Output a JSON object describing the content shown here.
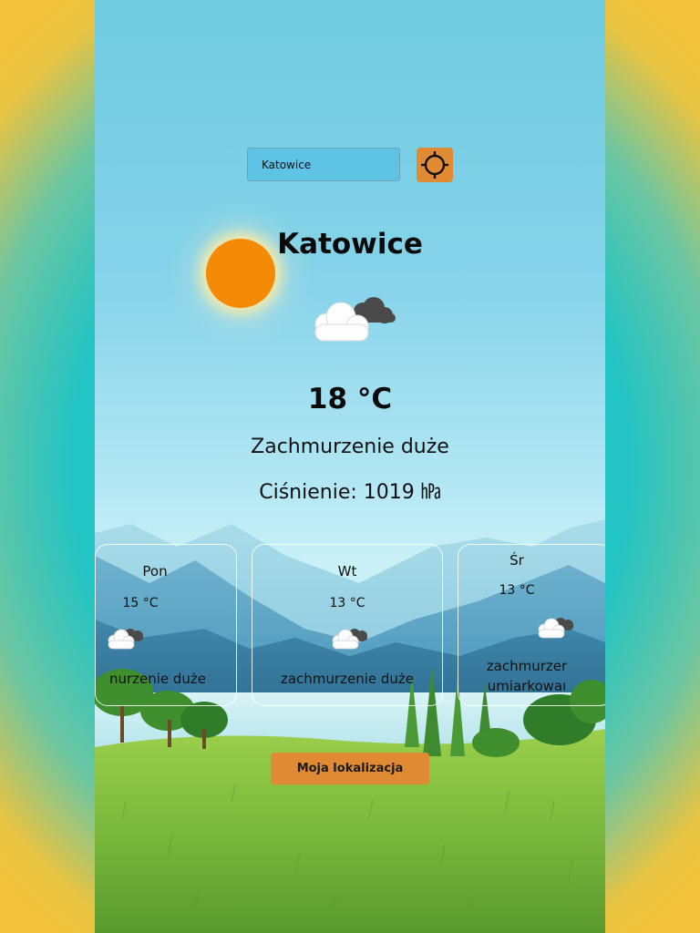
{
  "search": {
    "value": "Katowice"
  },
  "current": {
    "city": "Katowice",
    "temperature": "18 °C",
    "description": "Zachmurzenie duże",
    "pressure": "Ciśnienie: 1019 ㍱",
    "icon": "cloud-sun-icon"
  },
  "forecast": [
    {
      "day": "Pon",
      "temperature": "15 °C",
      "description": "nurzenie duże",
      "icon": "cloudy-icon"
    },
    {
      "day": "Wt",
      "temperature": "13 °C",
      "description": "zachmurzenie duże",
      "icon": "cloudy-icon"
    },
    {
      "day": "Śr",
      "temperature": "13 °C",
      "description": "zachmurzer\numiarkowaı",
      "icon": "cloudy-icon"
    }
  ],
  "buttons": {
    "my_location": "Moja lokalizacja"
  },
  "colors": {
    "accent": "#e08a33",
    "sun": "#f48a06",
    "sky": "#7fd0e6",
    "grass": "#7dbb3e"
  }
}
